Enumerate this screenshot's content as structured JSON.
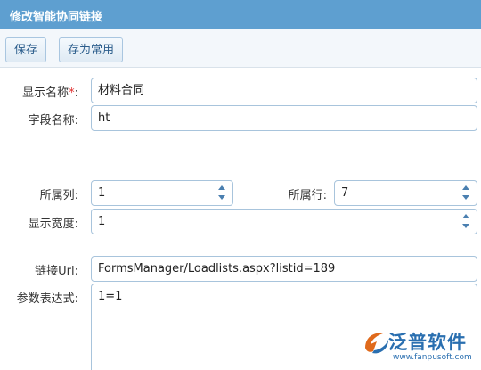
{
  "window": {
    "title": "修改智能协同链接"
  },
  "toolbar": {
    "save_label": "保存",
    "save_common_label": "存为常用"
  },
  "form": {
    "display_name": {
      "label": "显示名称",
      "required_mark": "*",
      "suffix": ":",
      "value": "材料合同"
    },
    "field_name": {
      "label": "字段名称:",
      "value": "ht"
    },
    "column": {
      "label": "所属列:",
      "value": "1"
    },
    "row": {
      "label": "所属行:",
      "value": "7"
    },
    "display_width": {
      "label": "显示宽度:",
      "value": "1"
    },
    "link_url": {
      "label": "链接Url:",
      "value": "FormsManager/Loadlists.aspx?listid=189"
    },
    "param_expr": {
      "label": "参数表达式:",
      "value": "1=1"
    }
  },
  "watermark": {
    "brand": "泛普软件",
    "url": "www.fanpusoft.com"
  },
  "colors": {
    "titlebar": "#5e9fd0",
    "button_text": "#2b5d8c",
    "field_border": "#a8c4dc",
    "watermark": "#2a6fb0"
  }
}
